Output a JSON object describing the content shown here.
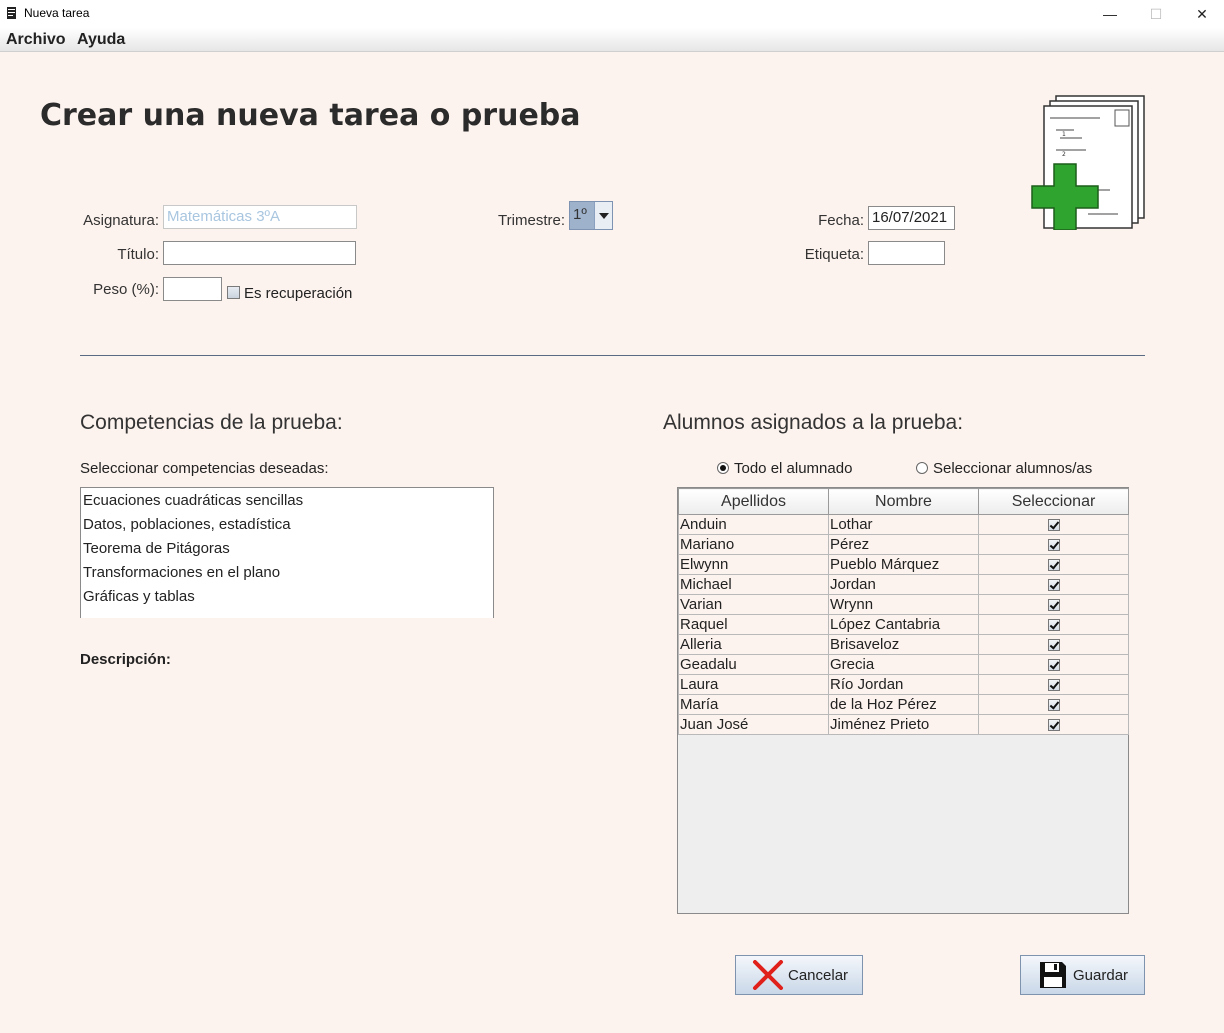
{
  "window": {
    "title": "Nueva tarea",
    "minimize": "—",
    "maximize": "☐",
    "close": "✕"
  },
  "menu": [
    "Archivo",
    "Ayuda"
  ],
  "page_title": "Crear una nueva tarea o prueba",
  "form": {
    "asignatura_label": "Asignatura:",
    "asignatura_value": "Matemáticas 3ºA",
    "titulo_label": "Título:",
    "titulo_value": "",
    "peso_label": "Peso (%):",
    "peso_value": "",
    "recuperacion_label": "Es recuperación",
    "recuperacion_checked": false,
    "trimestre_label": "Trimestre:",
    "trimestre_value": "1º",
    "fecha_label": "Fecha:",
    "fecha_value": "16/07/2021",
    "etiqueta_label": "Etiqueta:",
    "etiqueta_value": ""
  },
  "competencias": {
    "title": "Competencias de la prueba:",
    "subtitle": "Seleccionar competencias deseadas:",
    "items": [
      "Ecuaciones cuadráticas sencillas",
      "Datos, poblaciones, estadística",
      "Teorema de Pitágoras",
      "Transformaciones en el plano",
      "Gráficas y tablas"
    ],
    "description_label": "Descripción:"
  },
  "alumnos": {
    "title": "Alumnos asignados a la prueba:",
    "radio_all": "Todo el alumnado",
    "radio_select": "Seleccionar alumnos/as",
    "selected_mode": "all",
    "columns": [
      "Apellidos",
      "Nombre",
      "Seleccionar"
    ],
    "rows": [
      {
        "apellidos": "Anduin",
        "nombre": "Lothar",
        "selected": true
      },
      {
        "apellidos": "Mariano",
        "nombre": "Pérez",
        "selected": true
      },
      {
        "apellidos": "Elwynn",
        "nombre": "Pueblo Márquez",
        "selected": true
      },
      {
        "apellidos": "Michael",
        "nombre": "Jordan",
        "selected": true
      },
      {
        "apellidos": "Varian",
        "nombre": "Wrynn",
        "selected": true
      },
      {
        "apellidos": "Raquel",
        "nombre": "López Cantabria",
        "selected": true
      },
      {
        "apellidos": "Alleria",
        "nombre": "Brisaveloz",
        "selected": true
      },
      {
        "apellidos": "Geadalu",
        "nombre": "Grecia",
        "selected": true
      },
      {
        "apellidos": "Laura",
        "nombre": "Río Jordan",
        "selected": true
      },
      {
        "apellidos": "María",
        "nombre": "de la Hoz Pérez",
        "selected": true
      },
      {
        "apellidos": "Juan José",
        "nombre": "Jiménez Prieto",
        "selected": true
      }
    ]
  },
  "buttons": {
    "cancel": "Cancelar",
    "save": "Guardar"
  },
  "colors": {
    "background": "#fdf3ee",
    "plus_green": "#2fa52f",
    "cancel_red": "#e0201a"
  },
  "icons": {
    "app": "document-icon",
    "hero": "new-document-plus-icon",
    "cancel": "red-x-icon",
    "save": "floppy-disk-icon"
  }
}
